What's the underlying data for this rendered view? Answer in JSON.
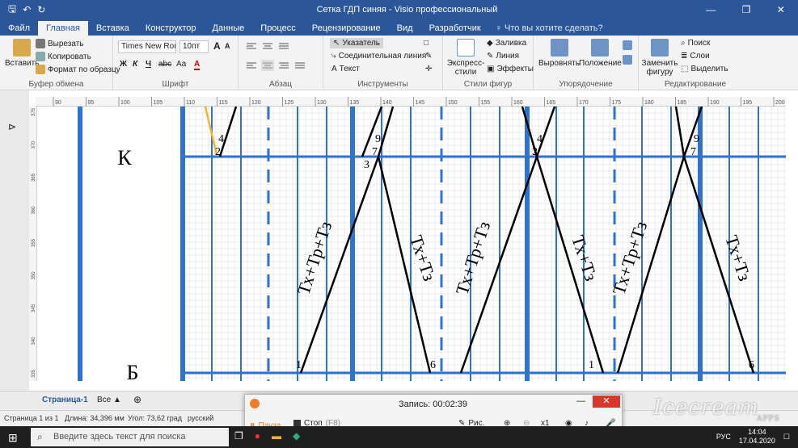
{
  "titlebar": {
    "title": "Сетка ГДП синяя - Visio профессиональный",
    "qat_save": "🖫",
    "qat_undo": "↶",
    "qat_redo": "↻",
    "minimize": "—",
    "restore": "❐",
    "close": "✕"
  },
  "tabs": {
    "items": [
      "Файл",
      "Главная",
      "Вставка",
      "Конструктор",
      "Данные",
      "Процесс",
      "Рецензирование",
      "Вид",
      "Разработчик"
    ],
    "tell": "♀ Что вы хотите сделать?"
  },
  "ribbon": {
    "clipboard": {
      "paste": "Вставить",
      "cut": "Вырезать",
      "copy": "Копировать",
      "format_painter": "Формат по образцу",
      "label": "Буфер обмена"
    },
    "font": {
      "font_name": "Times New Roman",
      "font_size": "10пт",
      "bold": "Ж",
      "italic": "К",
      "underline": "Ч",
      "strike": "abc",
      "case": "Aa",
      "color": "A",
      "grow": "A",
      "shrink": "A",
      "label": "Шрифт"
    },
    "paragraph": {
      "label": "Абзац"
    },
    "tools": {
      "pointer": "Указатель",
      "connector": "Соединительная линия",
      "text": "Текст",
      "label": "Инструменты"
    },
    "styles": {
      "express": "Экспресс-стили",
      "fill": "Заливка",
      "line": "Линия",
      "effects": "Эффекты",
      "label": "Стили фигур"
    },
    "arrange": {
      "align": "Выровнять",
      "position": "Положение",
      "label": "Упорядочение"
    },
    "editing": {
      "replace": "Заменить фигуру",
      "find": "Поиск",
      "layers": "Слои",
      "select": "Выделить",
      "label": "Редактирование"
    }
  },
  "ruler": {
    "h_ticks": [
      "90",
      "95",
      "100",
      "105",
      "110",
      "115",
      "120",
      "125",
      "130",
      "135",
      "140",
      "145",
      "150",
      "155",
      "160",
      "165",
      "170",
      "175",
      "180",
      "185",
      "190",
      "195",
      "200"
    ],
    "v_ticks": [
      "375",
      "370",
      "365",
      "360",
      "355",
      "350",
      "345",
      "340",
      "335"
    ]
  },
  "diagram": {
    "station_top": "К",
    "station_bottom": "Б",
    "label_up": "Тх+Тр+Тз",
    "label_down": "Тх+Тз",
    "points": [
      "4",
      "2",
      "9",
      "7",
      "3",
      "4",
      "2",
      "9",
      "7",
      "1",
      "6",
      "1",
      "6"
    ],
    "colors": {
      "blue": "#2f73d2",
      "grid": "#d8d8d8",
      "orange": "#f2b52a"
    }
  },
  "pagebar": {
    "page": "Страница-1",
    "all": "Все ▲",
    "add": "⊕"
  },
  "status": {
    "page_of": "Страница 1 из 1",
    "length": "Длина: 34,396 мм",
    "angle": "Угол: 73,62 град",
    "lang": "русский"
  },
  "recorder": {
    "time_label": "Запись:",
    "time": "00:02:39",
    "pause": "Пауза",
    "stop": "Стоп",
    "stop_key": "(F8)",
    "draw": "Рис.",
    "zoom": "x1"
  },
  "taskbar": {
    "search_placeholder": "Введите здесь текст для поиска",
    "lang": "РУС",
    "time": "14:04",
    "date": "17.04.2020"
  },
  "watermark": {
    "text": "Icecream",
    "sub": "APPS"
  }
}
